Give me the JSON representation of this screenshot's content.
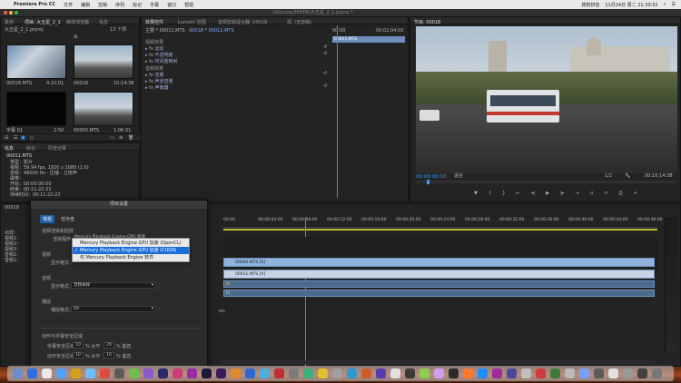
{
  "menubar": {
    "apple": "",
    "app": "Premiere Pro CC",
    "items": [
      "文件",
      "编辑",
      "剪辑",
      "序列",
      "标记",
      "字幕",
      "窗口",
      "帮助"
    ],
    "right": {
      "input": "搜狗拼音",
      "datetime": "11月24日 周二 21:39:52"
    }
  },
  "window": {
    "title": "/Volumes/HH/PR/大五星_2_1.prproj *"
  },
  "project_panel": {
    "tabs": [
      "项目: 大五星_2_1",
      "媒体浏览器",
      "信息"
    ],
    "file": "大五星_2_1.prproj",
    "count": "13 个项",
    "items": [
      {
        "name": "00018.MTS",
        "duration": "4:22:01"
      },
      {
        "name": "00018",
        "duration": "10:14:38"
      },
      {
        "name": "字幕 01",
        "duration": "2:50"
      },
      {
        "name": "00000.MTS",
        "duration": "1:06:31"
      }
    ]
  },
  "info_panel": {
    "tabs": [
      "信息",
      "标记",
      "历史记录"
    ],
    "title": "00011.MTS",
    "lines": [
      "类型：影片",
      "视频：59.94 fps, 1920 x 1080 (1.0)",
      "音频：48000 Hz - 压缩 - 立体声",
      "磁带：",
      "开始：00:00:00:00",
      "结束：00:11:22:21",
      "持续时间：00:11:22:22"
    ],
    "extra": [
      "出现：",
      "视频1：",
      "视频2：",
      "视频3：",
      "音频1：",
      "音频2："
    ]
  },
  "effect_controls": {
    "tabs": [
      "效果控件",
      "Lumetri 范围",
      "音频剪辑混合器: 00018",
      "源: (无剪辑)"
    ],
    "source": "主要 * 00011.MTS",
    "seq": "00018 * 00011.MTS",
    "timecodes": [
      "00:00",
      "00:01:04:00"
    ],
    "clip_label": "00011.MTS",
    "video_header": "视频效果",
    "video_items": [
      "运动",
      "不透明度",
      "时间重映射"
    ],
    "audio_header": "音频效果",
    "audio_items": [
      "音量",
      "声道音量",
      "声像器"
    ]
  },
  "program_monitor": {
    "tab": "节目: 00018",
    "timecode": "00:00:00:10",
    "fit": "适合",
    "ratio": "1/2",
    "duration": "00:10:14:38"
  },
  "timeline": {
    "tab": "00018",
    "ruler": [
      "00:00",
      "00:00:04:00",
      "00:00:08:00",
      "00:00:12:00",
      "00:00:16:00",
      "00:00:20:00",
      "00:00:24:00",
      "00:00:28:00",
      "00:00:32:00",
      "00:00:36:00",
      "00:00:40:00",
      "00:00:44:00",
      "00:00:48:00"
    ],
    "clips": [
      "00000.MTS [V]",
      "00011.MTS [V]"
    ]
  },
  "dialog": {
    "title": "项目设置",
    "tabs": [
      "常规",
      "暂存盘"
    ],
    "renderer_section": "视频渲染和回放",
    "renderer_label": "渲染程序：",
    "renderer_value": "Mercury Playback Engine GPU 加速 (CUDA)",
    "dropdown_options": [
      "Mercury Playback Engine GPU 加速 (OpenCL)",
      "Mercury Playback Engine GPU 加速 (CUDA)",
      "仅 Mercury Playback Engine 软件"
    ],
    "video_section": "视频",
    "video_display_label": "显示格式：",
    "audio_section": "音频",
    "audio_display_label": "显示格式：",
    "audio_display_value": "音频采样",
    "capture_section": "捕捉",
    "capture_label": "捕捉格式：",
    "capture_value": "DV",
    "safe_section": "动作与字幕安全区域",
    "title_safe_label": "字幕安全区域",
    "title_safe": [
      "10",
      "20"
    ],
    "action_safe_label": "动作安全区域",
    "action_safe": [
      "10",
      "10"
    ],
    "unit_h": "% 水平",
    "unit_v": "% 垂直"
  }
}
